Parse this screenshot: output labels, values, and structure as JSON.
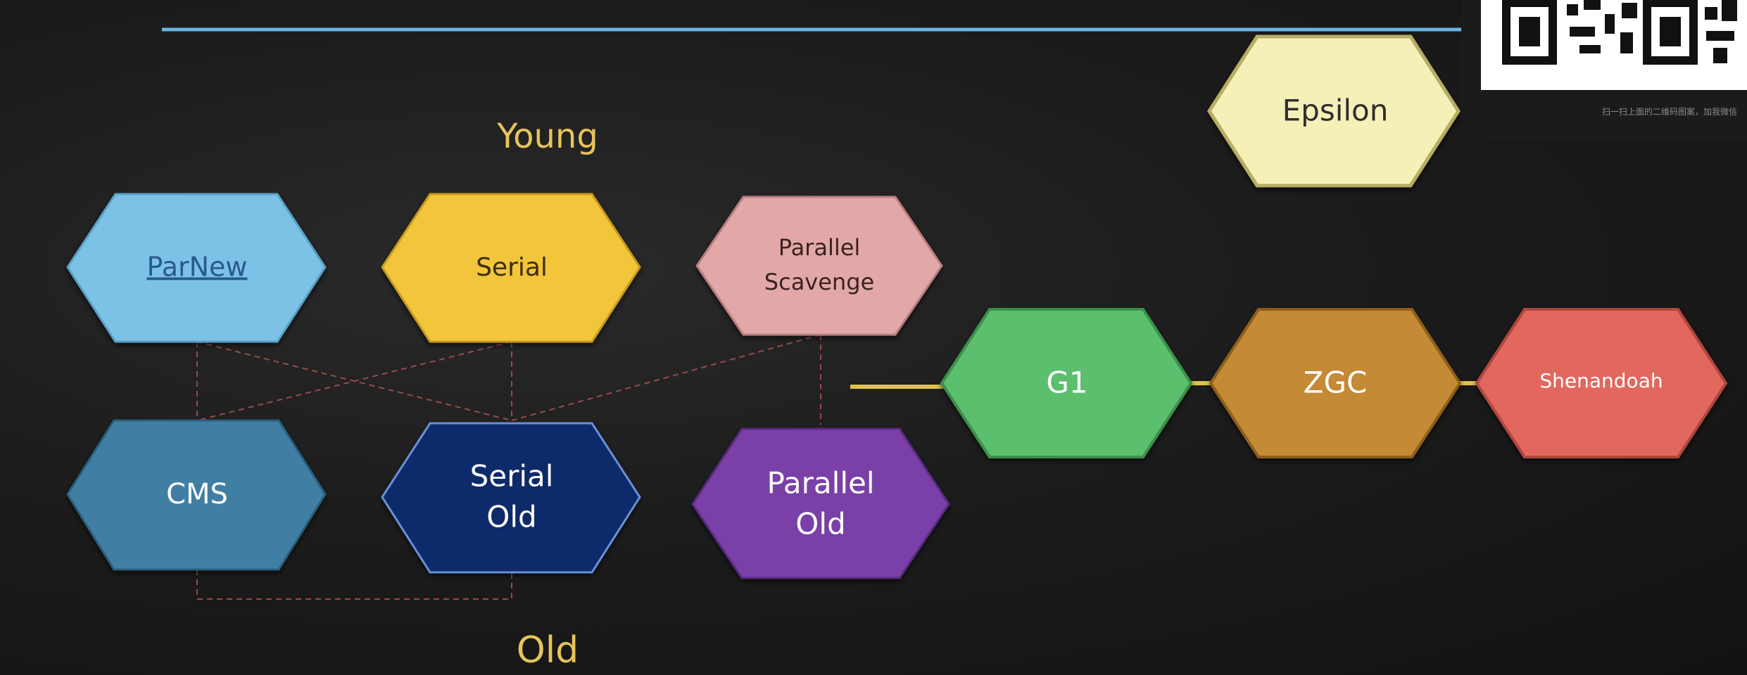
{
  "labels": {
    "young": "Young",
    "old": "Old"
  },
  "collectors": {
    "parnew": "ParNew",
    "serial": "Serial",
    "parallel_scavenge_1": "Parallel",
    "parallel_scavenge_2": "Scavenge",
    "cms": "CMS",
    "serial_old_1": "Serial",
    "serial_old_2": "Old",
    "parallel_old_1": "Parallel",
    "parallel_old_2": "Old",
    "g1": "G1",
    "zgc": "ZGC",
    "shenandoah": "Shenandoah",
    "epsilon": "Epsilon"
  },
  "colors": {
    "parnew": "#7cc2e6",
    "serial": "#f3c53b",
    "parallel_scavenge": "#e2a8a8",
    "cms": "#3f7fa3",
    "serial_old": "#0f2a6b",
    "parallel_old": "#7a3fa8",
    "g1": "#5bbf6e",
    "zgc": "#c58a35",
    "shenandoah": "#e2685f",
    "epsilon": "#f5f0b8",
    "accent_line": "#6bb6e0",
    "label": "#e8c45a"
  },
  "qr": {
    "caption": "扫一扫上面的二维码图案，加我微信"
  }
}
